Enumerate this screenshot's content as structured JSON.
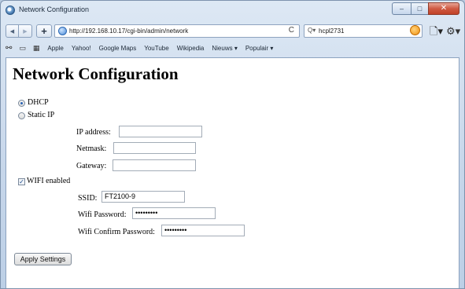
{
  "window": {
    "title": "Network Configuration",
    "minimize": "–",
    "maximize": "□",
    "close": "✕"
  },
  "nav": {
    "back": "◀",
    "forward": "▶",
    "new_tab": "+",
    "url": "http://192.168.10.17/cgi-bin/admin/network",
    "reload": "C",
    "search_icon": "Q▾",
    "search_value": "hcpl2731",
    "page_menu": "🗋▾",
    "gear_menu": "⚙▾"
  },
  "bookmarks": {
    "icons": [
      "reader-glasses-icon",
      "book-icon",
      "grid-icon"
    ],
    "items": [
      "Apple",
      "Yahoo!",
      "Google Maps",
      "YouTube",
      "Wikipedia",
      "Nieuws ▾",
      "Populair ▾"
    ]
  },
  "page": {
    "heading": "Network Configuration",
    "dhcp_label": "DHCP",
    "static_ip_label": "Static IP",
    "selected_mode": "DHCP",
    "ip_label": "IP address:",
    "ip_value": "",
    "netmask_label": "Netmask:",
    "netmask_value": "",
    "gateway_label": "Gateway:",
    "gateway_value": "",
    "wifi_label": "WIFI enabled",
    "wifi_checked": true,
    "ssid_label": "SSID:",
    "ssid_value": "FT2100-9",
    "wifi_password_label": "Wifi Password:",
    "wifi_password_mask": "•••••••••",
    "wifi_confirm_label": "Wifi Confirm Password:",
    "wifi_confirm_mask": "•••••••••",
    "apply_label": "Apply Settings"
  }
}
